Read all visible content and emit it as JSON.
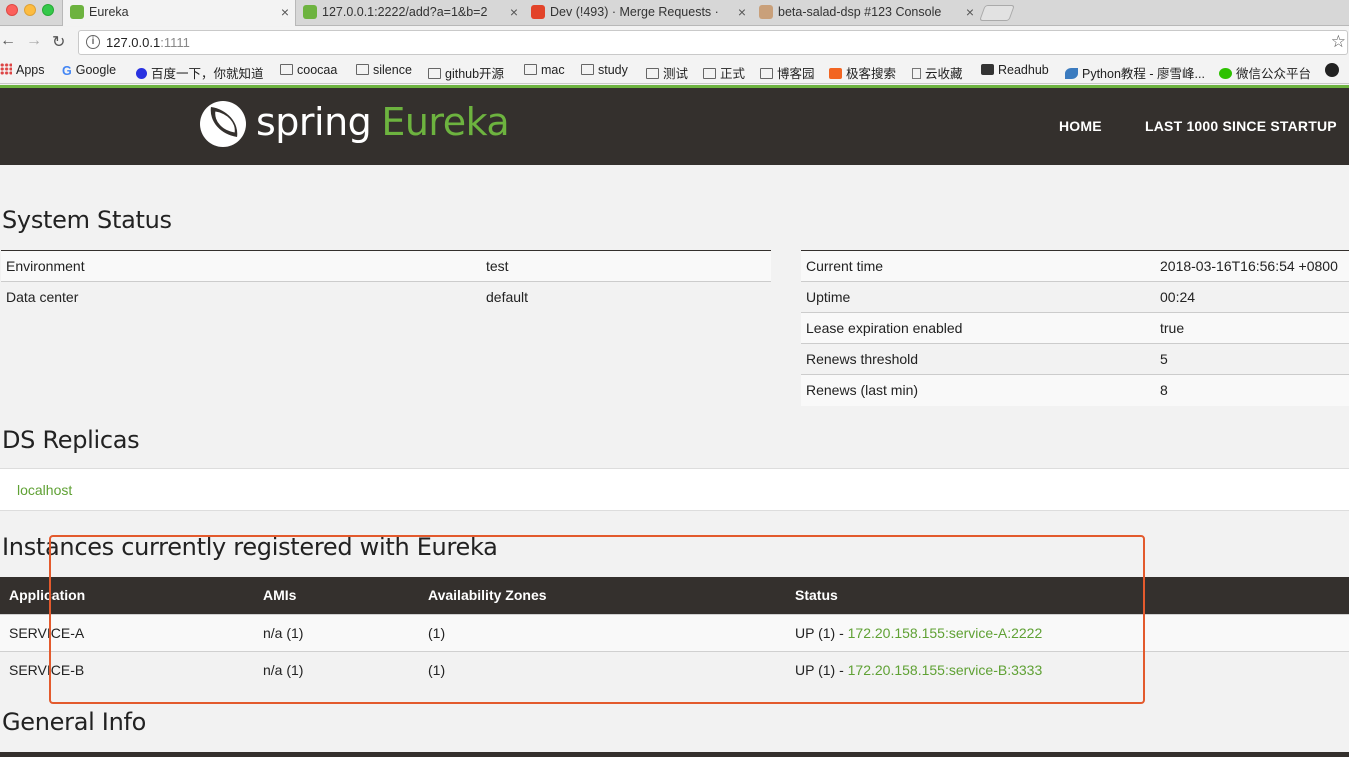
{
  "browser": {
    "tabs": [
      {
        "title": "Eureka",
        "active": true
      },
      {
        "title": "127.0.0.1:2222/add?a=1&b=2",
        "active": false
      },
      {
        "title": "Dev (!493) · Merge Requests ·",
        "active": false
      },
      {
        "title": "beta-salad-dsp #123 Console",
        "active": false
      }
    ],
    "close_glyph": "×",
    "url_host": "127.0.0.1",
    "url_port": ":1111",
    "bookmarks": [
      "Apps",
      "Google",
      "百度一下，你就知道",
      "coocaa",
      "silence",
      "github开源",
      "mac",
      "study",
      "测试",
      "正式",
      "博客园",
      "极客搜索",
      "云收藏",
      "Readhub",
      "Python教程 - 廖雪峰...",
      "微信公众平台"
    ]
  },
  "header": {
    "brand_spring": "spring",
    "brand_eureka": "Eureka",
    "nav": [
      "HOME",
      "LAST 1000 SINCE STARTUP"
    ]
  },
  "system_status": {
    "title": "System Status",
    "left": [
      {
        "label": "Environment",
        "value": "test"
      },
      {
        "label": "Data center",
        "value": "default"
      }
    ],
    "right": [
      {
        "label": "Current time",
        "value": "2018-03-16T16:56:54 +0800"
      },
      {
        "label": "Uptime",
        "value": "00:24"
      },
      {
        "label": "Lease expiration enabled",
        "value": "true"
      },
      {
        "label": "Renews threshold",
        "value": "5"
      },
      {
        "label": "Renews (last min)",
        "value": "8"
      }
    ]
  },
  "ds_replicas": {
    "title": "DS Replicas",
    "items": [
      "localhost"
    ]
  },
  "instances": {
    "title": "Instances currently registered with Eureka",
    "columns": [
      "Application",
      "AMIs",
      "Availability Zones",
      "Status"
    ],
    "rows": [
      {
        "application": "SERVICE-A",
        "amis": "n/a (1)",
        "zones": "(1)",
        "status_prefix": "UP (1) - ",
        "status_link": "172.20.158.155:service-A:2222"
      },
      {
        "application": "SERVICE-B",
        "amis": "n/a (1)",
        "zones": "(1)",
        "status_prefix": "UP (1) - ",
        "status_link": "172.20.158.155:service-B:3333"
      }
    ]
  },
  "general_info": {
    "title": "General Info"
  },
  "colors": {
    "spring_green": "#6db33f",
    "header_dark": "#34302d",
    "highlight_orange": "#e35a2d"
  }
}
